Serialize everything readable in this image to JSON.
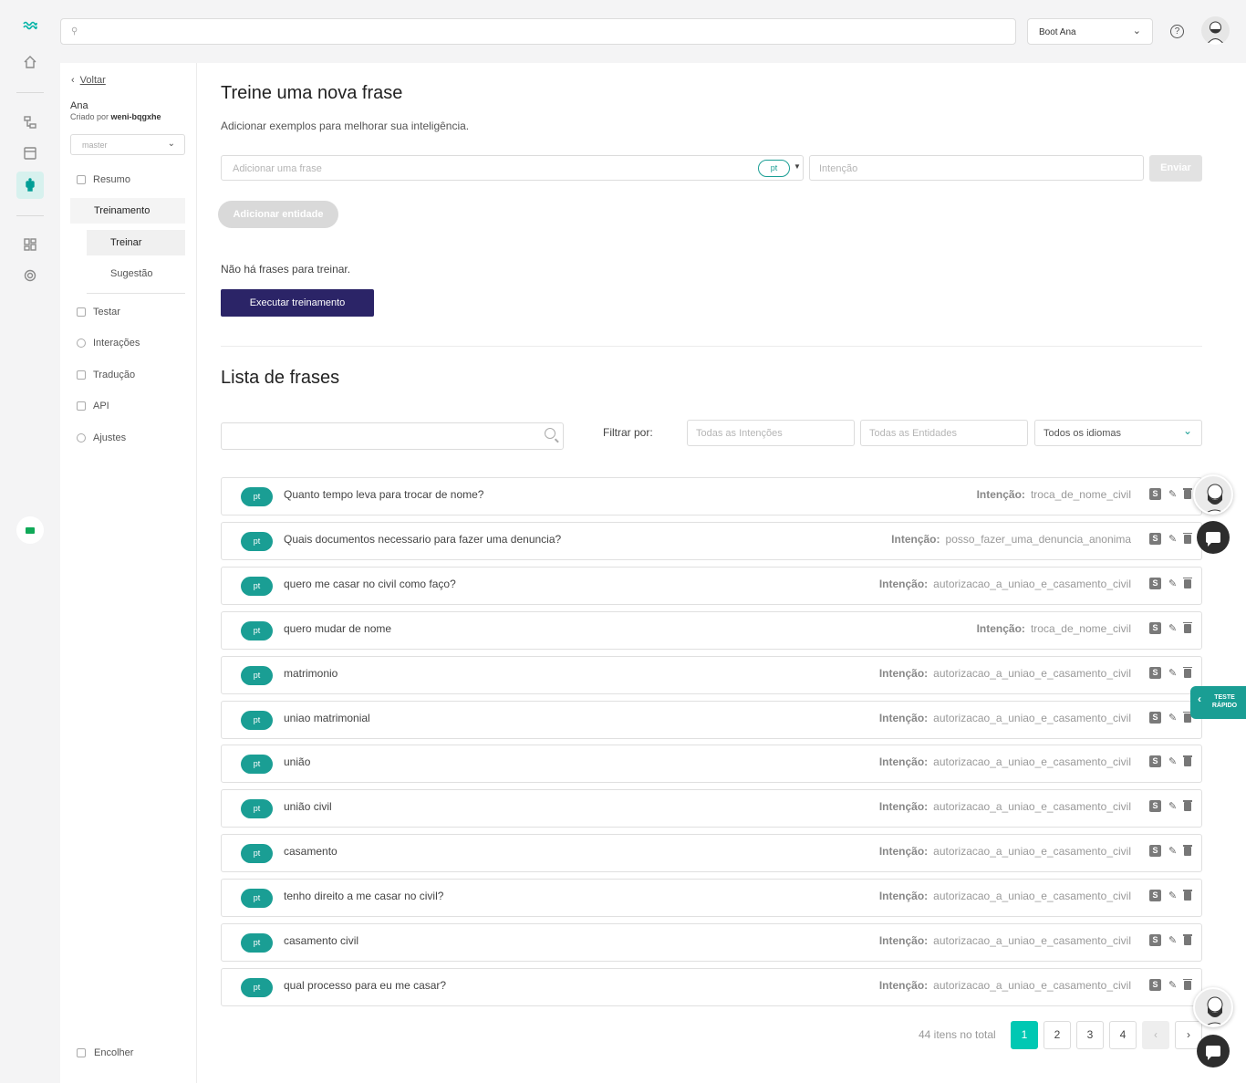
{
  "topbar": {
    "search_placeholder": "",
    "bot_selector": "Boot Ana",
    "help_label": "?"
  },
  "sidebar": {
    "back_label": "Voltar",
    "bot_name": "Ana",
    "created_by_label": "Criado por",
    "created_by_user": "weni-bqgxhe",
    "branch": "master",
    "items": [
      {
        "label": "Resumo"
      },
      {
        "label": "Treinamento"
      },
      {
        "label": "Treinar"
      },
      {
        "label": "Sugestão"
      },
      {
        "label": "Testar"
      },
      {
        "label": "Interações"
      },
      {
        "label": "Tradução"
      },
      {
        "label": "API"
      },
      {
        "label": "Ajustes"
      }
    ],
    "collapse_label": "Encolher"
  },
  "train": {
    "title": "Treine uma nova frase",
    "subtitle": "Adicionar exemplos para melhorar sua inteligência.",
    "phrase_placeholder": "Adicionar uma frase",
    "lang": "pt",
    "intent_placeholder": "Intenção",
    "send_label": "Enviar",
    "add_entity_label": "Adicionar entidade",
    "empty_message": "Não há frases para treinar.",
    "run_training_label": "Executar treinamento"
  },
  "list": {
    "title": "Lista de frases",
    "filter_label": "Filtrar por:",
    "all_intents_placeholder": "Todas as Intenções",
    "all_entities_placeholder": "Todas as Entidades",
    "languages_select": "Todos os idiomas",
    "intent_label": "Intenção:",
    "rows": [
      {
        "lang": "pt",
        "text": "Quanto tempo leva para trocar de nome?",
        "intent": "troca_de_nome_civil"
      },
      {
        "lang": "pt",
        "text": "Quais documentos necessario para fazer uma denuncia?",
        "intent": "posso_fazer_uma_denuncia_anonima"
      },
      {
        "lang": "pt",
        "text": "quero me casar no civil como faço?",
        "intent": "autorizacao_a_uniao_e_casamento_civil"
      },
      {
        "lang": "pt",
        "text": "quero mudar de nome",
        "intent": "troca_de_nome_civil"
      },
      {
        "lang": "pt",
        "text": "matrimonio",
        "intent": "autorizacao_a_uniao_e_casamento_civil"
      },
      {
        "lang": "pt",
        "text": "uniao matrimonial",
        "intent": "autorizacao_a_uniao_e_casamento_civil"
      },
      {
        "lang": "pt",
        "text": "união",
        "intent": "autorizacao_a_uniao_e_casamento_civil"
      },
      {
        "lang": "pt",
        "text": "união civil",
        "intent": "autorizacao_a_uniao_e_casamento_civil"
      },
      {
        "lang": "pt",
        "text": "casamento",
        "intent": "autorizacao_a_uniao_e_casamento_civil"
      },
      {
        "lang": "pt",
        "text": "tenho direito a me casar no civil?",
        "intent": "autorizacao_a_uniao_e_casamento_civil"
      },
      {
        "lang": "pt",
        "text": "casamento civil",
        "intent": "autorizacao_a_uniao_e_casamento_civil"
      },
      {
        "lang": "pt",
        "text": "qual processo para eu me casar?",
        "intent": "autorizacao_a_uniao_e_casamento_civil"
      }
    ],
    "sentence_badge": "S",
    "total_label": "44 itens no total",
    "pages": [
      "1",
      "2",
      "3",
      "4"
    ],
    "prev_label": "‹",
    "next_label": "›"
  },
  "quick_test": {
    "line1": "TESTE",
    "line2": "RÁPIDO",
    "arrow": "‹"
  },
  "colors": {
    "accent": "#1a9e94",
    "primary_button": "#2b2467",
    "page_active": "#00c8b3"
  }
}
